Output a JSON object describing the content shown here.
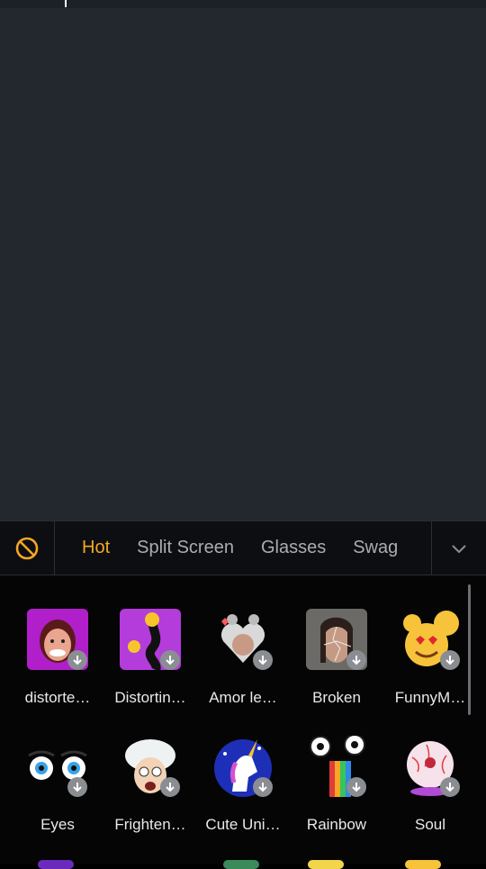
{
  "colors": {
    "accent": "#f5a623",
    "tab_inactive": "#a9adb3",
    "label": "#e9e9e9"
  },
  "toolbar": {
    "no_filter_icon": "no-filter-icon",
    "expand_icon": "chevron-down-icon"
  },
  "tabs": [
    "Hot",
    "Split Screen",
    "Glasses",
    "Swag"
  ],
  "active_tab": "Hot",
  "row1": [
    {
      "label": "distorte…",
      "icon": "distorted-face-thumbnail"
    },
    {
      "label": "Distortin…",
      "icon": "distorting-thumbnail"
    },
    {
      "label": "Amor le…",
      "icon": "amor-thumbnail"
    },
    {
      "label": "Broken",
      "icon": "broken-glass-thumbnail"
    },
    {
      "label": "FunnyM…",
      "icon": "funny-emoji-thumbnail"
    }
  ],
  "row2": [
    {
      "label": "Eyes",
      "icon": "eyes-thumbnail"
    },
    {
      "label": "Frighten…",
      "icon": "frighten-thumbnail"
    },
    {
      "label": "Cute Uni…",
      "icon": "unicorn-thumbnail"
    },
    {
      "label": "Rainbow",
      "icon": "rainbow-thumbnail"
    },
    {
      "label": "Soul",
      "icon": "soul-thumbnail"
    }
  ]
}
